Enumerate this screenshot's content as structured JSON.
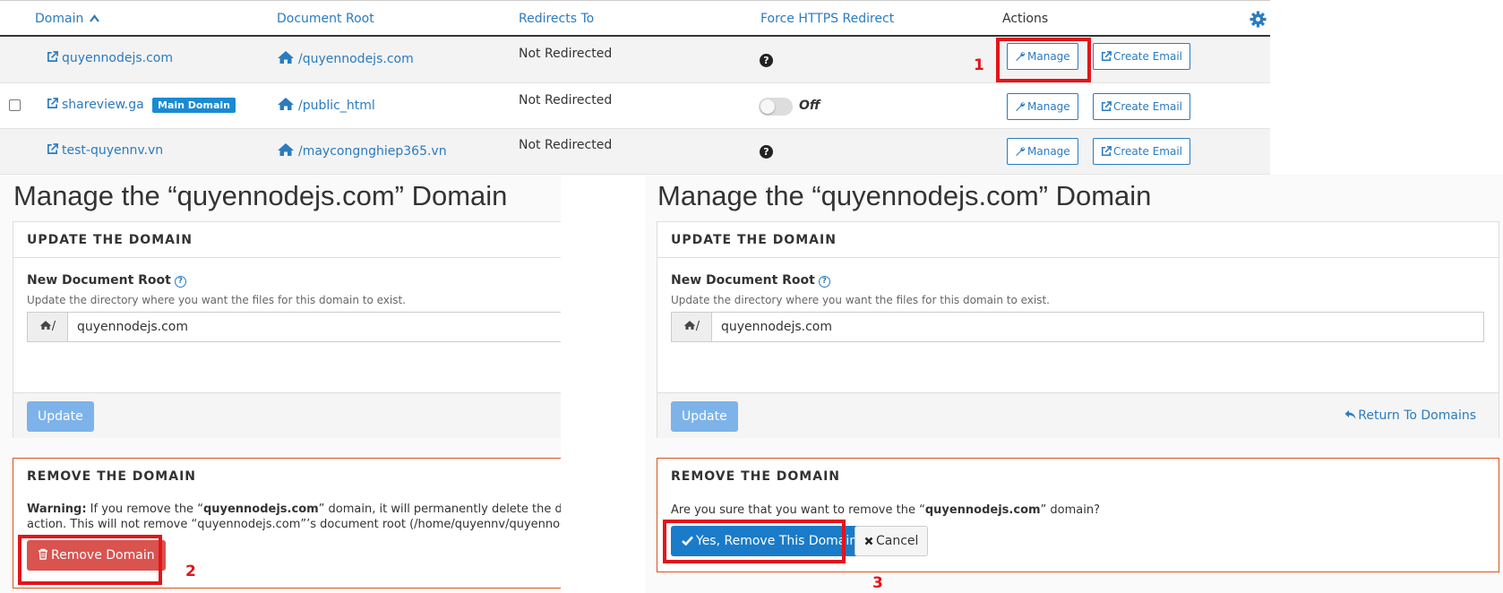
{
  "table": {
    "headers": {
      "domain": "Domain",
      "document_root": "Document Root",
      "redirects_to": "Redirects To",
      "force_https": "Force HTTPS Redirect",
      "actions": "Actions"
    },
    "rows": [
      {
        "domain": "quyennodejs.com",
        "root": "/quyennodejs.com",
        "redirect": "Not Redirected",
        "https": "help",
        "manage": "Manage",
        "email": "Create Email"
      },
      {
        "domain": "shareview.ga",
        "badge": "Main Domain",
        "root": "/public_html",
        "redirect": "Not Redirected",
        "https": "Off",
        "manage": "Manage",
        "email": "Create Email"
      },
      {
        "domain": "test-quyennv.vn",
        "root": "/maycongnghiep365.vn",
        "redirect": "Not Redirected",
        "https": "help",
        "manage": "Manage",
        "email": "Create Email"
      }
    ]
  },
  "left_panel": {
    "title": "Manage the “quyennodejs.com” Domain",
    "update_heading": "UPDATE THE DOMAIN",
    "field_label": "New Document Root",
    "field_hint": "Update the directory where you want the files for this domain to exist.",
    "addon": "/",
    "field_value": "quyennodejs.com",
    "update_button": "Update",
    "remove_heading": "REMOVE THE DOMAIN",
    "warning_label": "Warning:",
    "warning_line1_a": " If you remove the “",
    "warning_domain": "quyennodejs.com",
    "warning_line1_b": "” domain, it will permanently delete the dom",
    "warning_line2": "action. This will not remove “quyennodejs.com”’s document root (/home/quyennv/quyennod",
    "remove_button": "Remove Domain"
  },
  "right_panel": {
    "title": "Manage the “quyennodejs.com” Domain",
    "update_heading": "UPDATE THE DOMAIN",
    "field_label": "New Document Root",
    "field_hint": "Update the directory where you want the files for this domain to exist.",
    "addon": "/",
    "field_value": "quyennodejs.com",
    "update_button": "Update",
    "return_link": "Return To Domains",
    "remove_heading": "REMOVE THE DOMAIN",
    "confirm_a": "Are you sure that you want to remove the “",
    "confirm_domain": "quyennodejs.com",
    "confirm_b": "” domain?",
    "yes_button": "Yes, Remove This Domain",
    "cancel_button": "Cancel"
  },
  "annotations": {
    "step1": "1",
    "step2": "2",
    "step3": "3"
  },
  "colors": {
    "link": "#2a7bbf",
    "highlight": "#e3141b",
    "danger": "#d9534f",
    "primary": "#1a7bc9"
  }
}
